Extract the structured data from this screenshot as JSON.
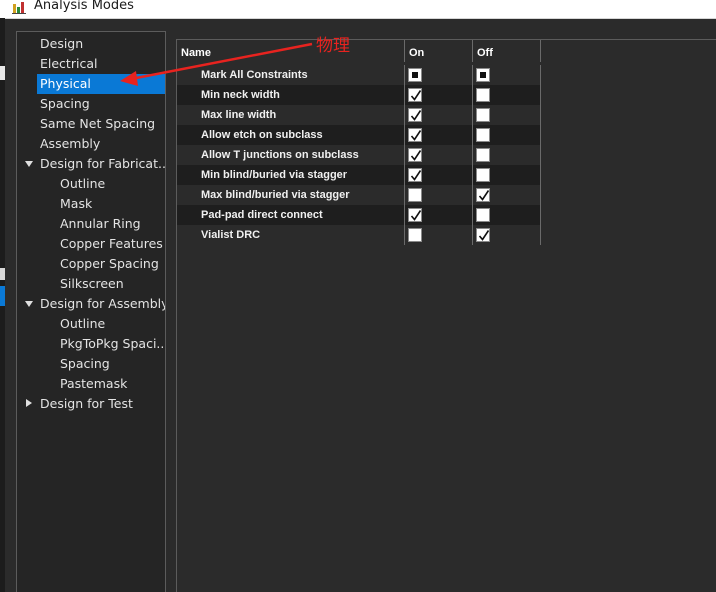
{
  "window": {
    "title": "Analysis Modes"
  },
  "annotation": {
    "text": "物理",
    "color": "#e8231f"
  },
  "tree": [
    {
      "label": "Design",
      "level": 0,
      "expander": "none"
    },
    {
      "label": "Electrical",
      "level": 0,
      "expander": "none"
    },
    {
      "label": "Physical",
      "level": 0,
      "expander": "none",
      "selected": true
    },
    {
      "label": "Spacing",
      "level": 0,
      "expander": "none"
    },
    {
      "label": "Same Net Spacing",
      "level": 0,
      "expander": "none"
    },
    {
      "label": "Assembly",
      "level": 0,
      "expander": "none"
    },
    {
      "label": "Design for Fabricat...",
      "level": 0,
      "expander": "expanded"
    },
    {
      "label": "Outline",
      "level": 1,
      "expander": "none"
    },
    {
      "label": "Mask",
      "level": 1,
      "expander": "none"
    },
    {
      "label": "Annular Ring",
      "level": 1,
      "expander": "none"
    },
    {
      "label": "Copper Features",
      "level": 1,
      "expander": "none"
    },
    {
      "label": "Copper Spacing",
      "level": 1,
      "expander": "none"
    },
    {
      "label": "Silkscreen",
      "level": 1,
      "expander": "none"
    },
    {
      "label": "Design for Assembly",
      "level": 0,
      "expander": "expanded"
    },
    {
      "label": "Outline",
      "level": 1,
      "expander": "none"
    },
    {
      "label": "PkgToPkg Spaci...",
      "level": 1,
      "expander": "none"
    },
    {
      "label": "Spacing",
      "level": 1,
      "expander": "none"
    },
    {
      "label": "Pastemask",
      "level": 1,
      "expander": "none"
    },
    {
      "label": "Design for Test",
      "level": 0,
      "expander": "collapsed"
    }
  ],
  "grid": {
    "columns": [
      "Name",
      "On",
      "Off"
    ],
    "rows": [
      {
        "name": "Mark All Constraints",
        "on": "indeterminate",
        "off": "indeterminate"
      },
      {
        "name": "Min neck width",
        "on": "checked",
        "off": "unchecked"
      },
      {
        "name": "Max line width",
        "on": "checked",
        "off": "unchecked"
      },
      {
        "name": "Allow etch on subclass",
        "on": "checked",
        "off": "unchecked"
      },
      {
        "name": "Allow T junctions on subclass",
        "on": "checked",
        "off": "unchecked"
      },
      {
        "name": "Min blind/buried via stagger",
        "on": "checked",
        "off": "unchecked"
      },
      {
        "name": "Max blind/buried via stagger",
        "on": "unchecked",
        "off": "checked"
      },
      {
        "name": "Pad-pad direct connect",
        "on": "checked",
        "off": "unchecked"
      },
      {
        "name": "Vialist DRC",
        "on": "unchecked",
        "off": "checked"
      }
    ]
  },
  "colors": {
    "selection": "#0a79d6",
    "panel_bg": "#252525",
    "grid_bg": "#2b2b2b",
    "row_alt": "#1e1e1e"
  }
}
